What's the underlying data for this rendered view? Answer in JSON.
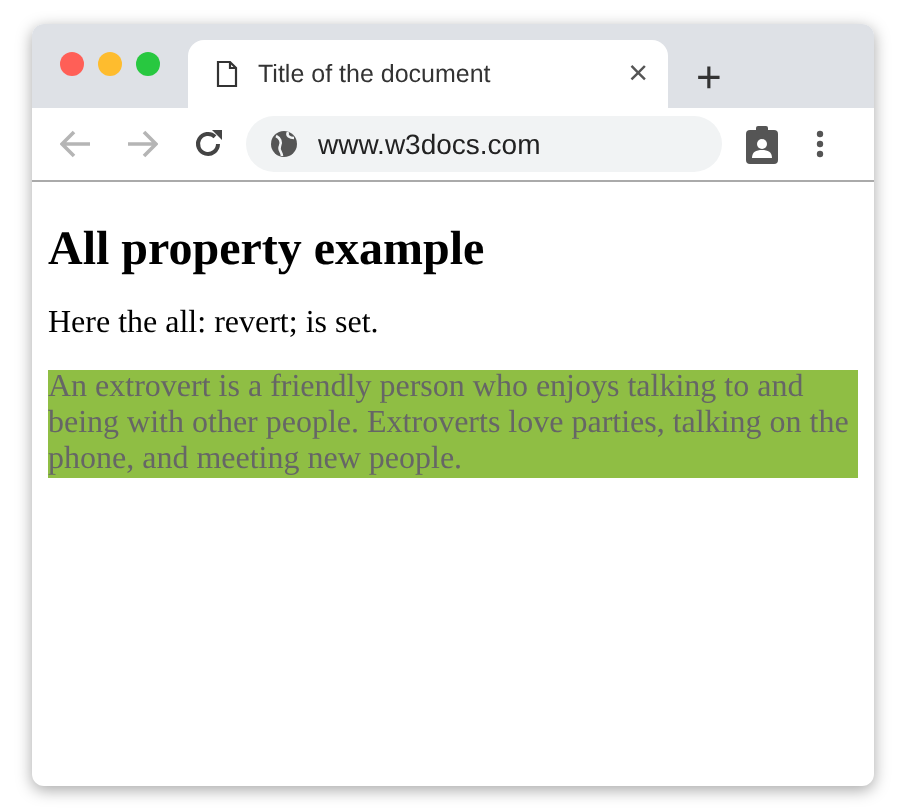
{
  "window": {
    "controls": [
      {
        "color": "#ff5f57"
      },
      {
        "color": "#febc2e"
      },
      {
        "color": "#28c840"
      }
    ]
  },
  "tabs": [
    {
      "label": "Title of the document",
      "selected": true,
      "close": "×"
    }
  ],
  "new_tab": "+",
  "toolbar": {
    "back_disabled": true,
    "forward_disabled": true,
    "address": "www.w3docs.com"
  },
  "page": {
    "heading": "All property example",
    "intro": "Here the all: revert; is set.",
    "highlight": "An extrovert is a friendly person who enjoys talking to and being with other people. Extroverts love parties, talking on the phone, and meeting new people."
  }
}
